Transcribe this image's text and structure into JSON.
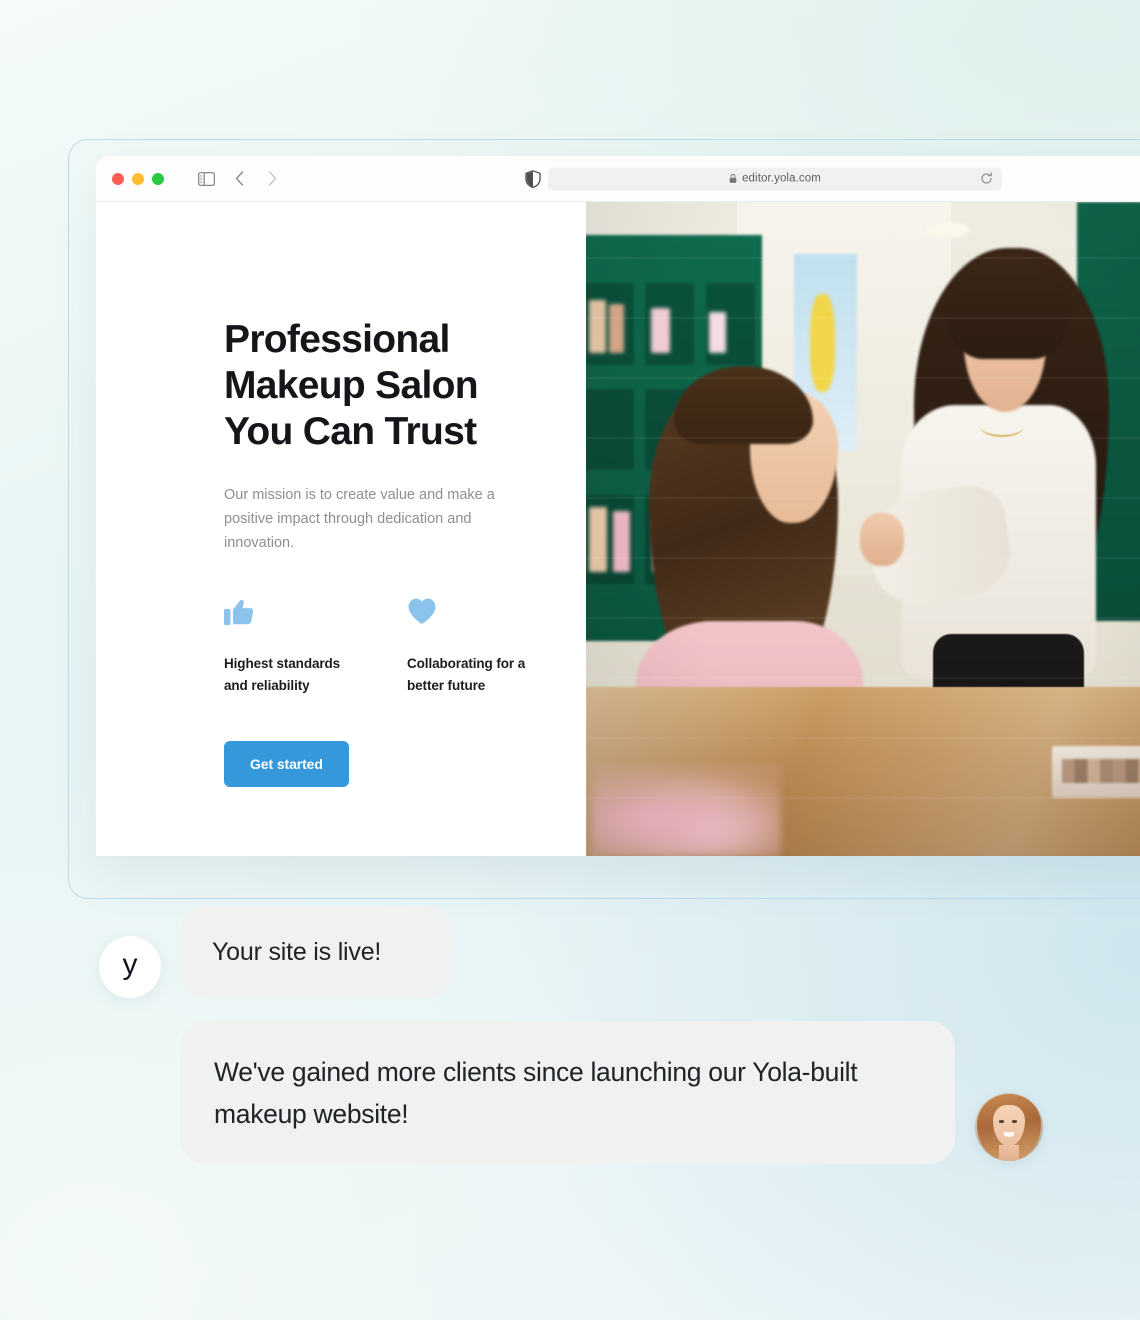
{
  "browser": {
    "window_controls": [
      "close",
      "minimize",
      "maximize"
    ],
    "sidebar_toggle_icon": "sidebar-toggle-icon",
    "back_icon": "chevron-left-icon",
    "forward_icon": "chevron-right-icon",
    "shield_icon": "privacy-shield-icon",
    "lock_icon": "lock-icon",
    "reload_icon": "reload-icon",
    "url": "editor.yola.com"
  },
  "site": {
    "headline": "Professional Makeup Salon You Can Trust",
    "subtext": "Our mission is to create value and make a positive impact through dedication and innovation.",
    "features": [
      {
        "icon": "thumbs-up-icon",
        "label": "Highest standards and reliability"
      },
      {
        "icon": "heart-icon",
        "label": "Collaborating for a better future"
      }
    ],
    "cta_label": "Get started",
    "hero_image_alt": "Makeup artist applying makeup to a client in a salon"
  },
  "chat": {
    "logo_letter": "y",
    "messages": [
      {
        "text": "Your site is live!",
        "sender": "yola"
      },
      {
        "text": "We've gained more clients since launching our Yola-built makeup website!",
        "sender": "customer"
      }
    ]
  },
  "colors": {
    "accent_blue": "#3498db",
    "icon_blue": "#8cc3ed",
    "heading": "#141619",
    "body_text": "#8c8f94",
    "bubble_bg": "#f0f1f1",
    "frame_border": "#bcdcec"
  }
}
